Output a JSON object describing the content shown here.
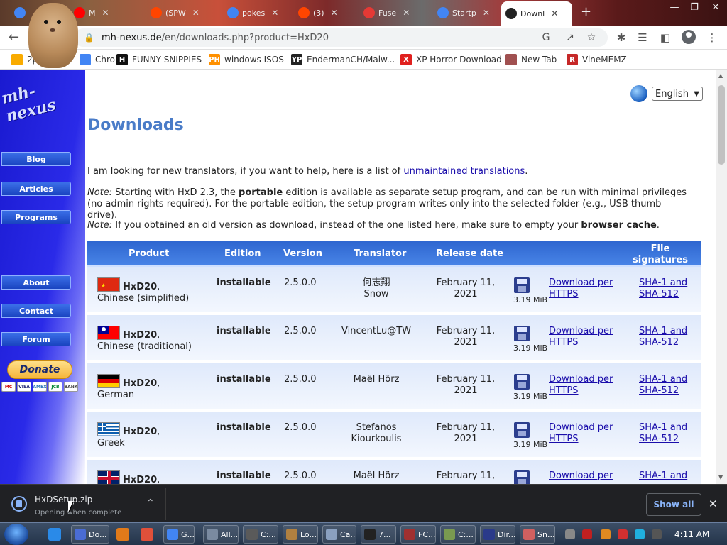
{
  "browser": {
    "tabs": [
      {
        "label": "",
        "favicon": "google-icon",
        "color": "#4285f4"
      },
      {
        "label": "M",
        "favicon": "youtube-icon",
        "color": "#ff0000"
      },
      {
        "label": "(SPW",
        "favicon": "reddit-icon",
        "color": "#ff4500"
      },
      {
        "label": "pokes",
        "favicon": "google-icon",
        "color": "#4285f4"
      },
      {
        "label": "(3)",
        "favicon": "reddit-icon",
        "color": "#ff4500"
      },
      {
        "label": "Fuse",
        "favicon": "pacman-icon",
        "color": "#e53935"
      },
      {
        "label": "Startp",
        "favicon": "google-icon",
        "color": "#4285f4"
      },
      {
        "label": "Downl",
        "favicon": "mh-nexus-icon",
        "color": "#222222",
        "active": true
      }
    ],
    "new_tab": "+",
    "url_host": "mh-nexus.de",
    "url_path": "/en/downloads.php?product=HxD20",
    "bookmarks": [
      {
        "label": "2p",
        "icon": "folder-icon",
        "color": "#f9ab00"
      },
      {
        "label": "Chro...",
        "icon": "chrome-icon",
        "color": "#4285f4"
      },
      {
        "label": "FUNNY SNIPPIES",
        "icon": "h-icon",
        "glyph": "H",
        "color": "#111111"
      },
      {
        "label": "windows ISOS",
        "icon": "ph-icon",
        "glyph": "PH",
        "color": "#ff9000"
      },
      {
        "label": "EndermanCH/Malw...",
        "icon": "yp-icon",
        "glyph": "YP",
        "color": "#222222"
      },
      {
        "label": "XP Horror Download",
        "icon": "x-icon",
        "glyph": "X",
        "color": "#e0201e"
      },
      {
        "label": "New Tab",
        "icon": "globe-icon",
        "color": "#a05050"
      },
      {
        "label": "VineMEMZ",
        "icon": "r-icon",
        "glyph": "R",
        "color": "#c62828"
      }
    ]
  },
  "site": {
    "logo": "mh-nexus",
    "nav": [
      "Blog",
      "Articles",
      "Programs",
      "About",
      "Contact",
      "Forum"
    ],
    "donate": "Donate",
    "cards": [
      "MC",
      "VISA",
      "AMEX",
      "JCB",
      "BANK"
    ],
    "language": "English"
  },
  "main": {
    "title": "Downloads",
    "intro_pre": "I am looking for new translators, if you want to help, here is a list of ",
    "intro_link": "unmaintained translations",
    "intro_post": ".",
    "note1_label": "Note:",
    "note1_a": " Starting with HxD 2.3, the ",
    "note1_bold": "portable",
    "note1_b": " edition is available as separate setup program, and can be run with minimal privileges (no admin rights required). For the portable edition, the setup program writes only into the selected folder (e.g., USB thumb drive).",
    "note2_label": "Note:",
    "note2_a": " If you obtained an old version as download, instead of the one listed here, make sure to empty your ",
    "note2_bold": "browser cache",
    "note2_b": "."
  },
  "table": {
    "headers": {
      "product": "Product",
      "edition": "Edition",
      "version": "Version",
      "translator": "Translator",
      "release": "Release date",
      "signatures_1": "File",
      "signatures_2": "signatures"
    },
    "rows": [
      {
        "flag": "cn",
        "name": "HxD20",
        "lang": "Chinese (simplified)",
        "edition": "installable",
        "version": "2.5.0.0",
        "translator_1": "何志翔",
        "translator_2": "Snow",
        "release_1": "February 11,",
        "release_2": "2021",
        "size": "3.19 MiB",
        "download_1": "Download per",
        "download_2": "HTTPS",
        "sha_1": "SHA-1 and",
        "sha_2": "SHA-512"
      },
      {
        "flag": "tw",
        "name": "HxD20",
        "lang": "Chinese (traditional)",
        "edition": "installable",
        "version": "2.5.0.0",
        "translator_1": "VincentLu@TW",
        "translator_2": "",
        "release_1": "February 11,",
        "release_2": "2021",
        "size": "3.19 MiB",
        "download_1": "Download per",
        "download_2": "HTTPS",
        "sha_1": "SHA-1 and",
        "sha_2": "SHA-512"
      },
      {
        "flag": "de",
        "name": "HxD20",
        "lang": "German",
        "edition": "installable",
        "version": "2.5.0.0",
        "translator_1": "Maël Hörz",
        "translator_2": "",
        "release_1": "February 11,",
        "release_2": "2021",
        "size": "3.19 MiB",
        "download_1": "Download per",
        "download_2": "HTTPS",
        "sha_1": "SHA-1 and",
        "sha_2": "SHA-512"
      },
      {
        "flag": "gr",
        "name": "HxD20",
        "lang": "Greek",
        "edition": "installable",
        "version": "2.5.0.0",
        "translator_1": "Stefanos",
        "translator_2": "Kiourkoulis",
        "release_1": "February 11,",
        "release_2": "2021",
        "size": "3.19 MiB",
        "download_1": "Download per",
        "download_2": "HTTPS",
        "sha_1": "SHA-1 and",
        "sha_2": "SHA-512"
      },
      {
        "flag": "gb",
        "name": "HxD20",
        "lang": "",
        "edition": "installable",
        "version": "2.5.0.0",
        "translator_1": "Maël Hörz",
        "translator_2": "",
        "release_1": "February 11,",
        "release_2": "",
        "size": "",
        "download_1": "Download per",
        "download_2": "",
        "sha_1": "SHA-1 and",
        "sha_2": ""
      }
    ]
  },
  "downloads_shelf": {
    "file": "HxDSetup.zip",
    "status": "Opening when complete",
    "show_all": "Show all"
  },
  "taskbar": {
    "apps": [
      {
        "label": "Do...",
        "color": "#4a6cd4"
      },
      {
        "label": "G...",
        "color": "#4285f4"
      },
      {
        "label": "All...",
        "color": "#7a8aa0"
      },
      {
        "label": "C:...",
        "color": "#5a5a5a"
      },
      {
        "label": "Lo...",
        "color": "#b08040"
      },
      {
        "label": "Ca...",
        "color": "#8aa0c0"
      },
      {
        "label": "7...",
        "color": "#222222"
      },
      {
        "label": "FC...",
        "color": "#a03030"
      },
      {
        "label": "C:...",
        "color": "#7a9a50"
      },
      {
        "label": "Dir...",
        "color": "#2a3a8a"
      },
      {
        "label": "Sn...",
        "color": "#d06060"
      }
    ],
    "time": "4:11 AM"
  }
}
